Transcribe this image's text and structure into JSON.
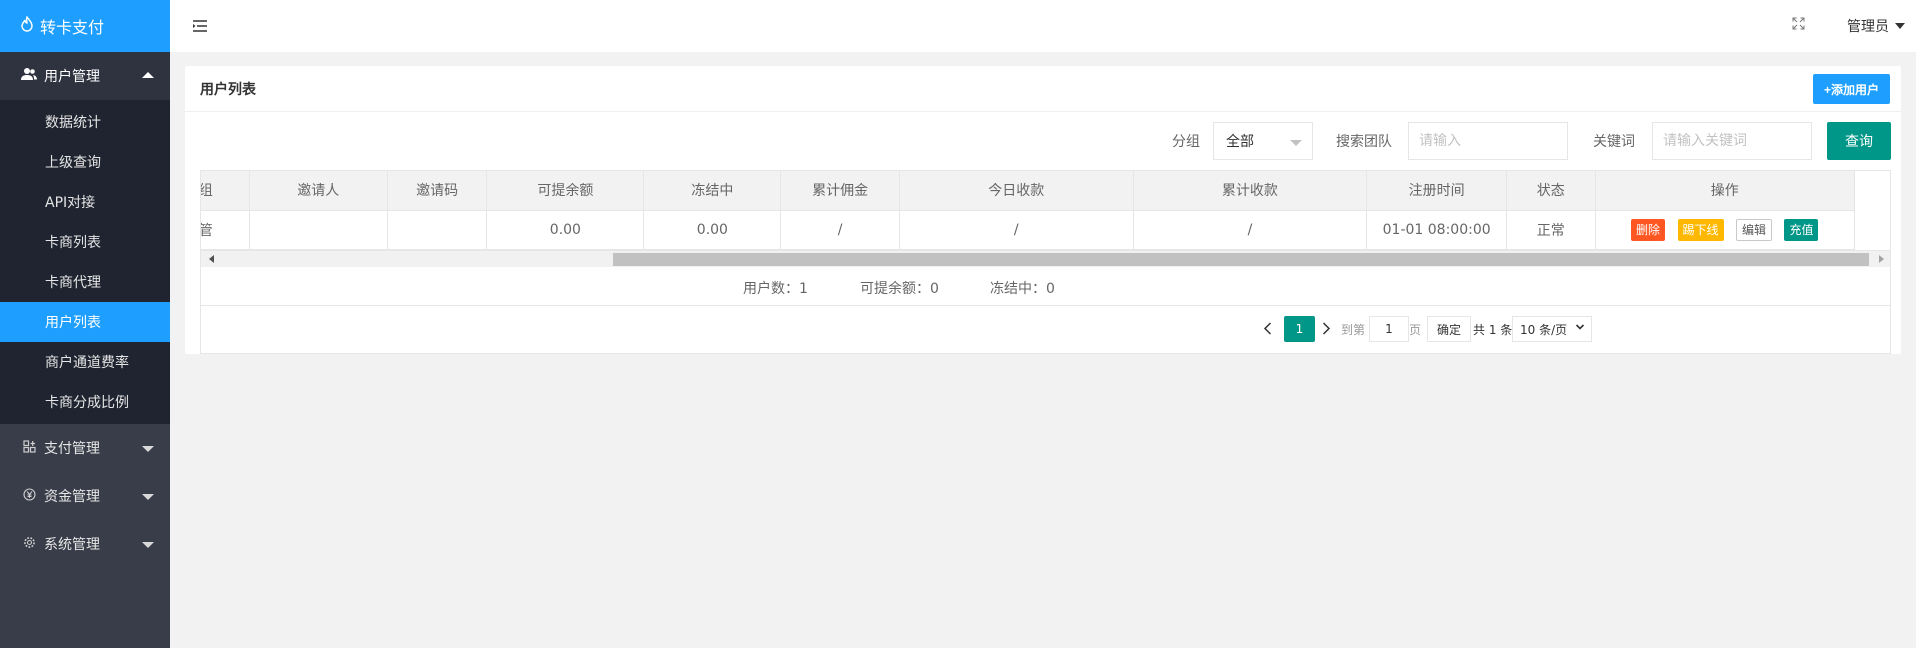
{
  "app": {
    "logo_text": "转卡支付",
    "logo_icon": "flame-icon"
  },
  "sidebar": {
    "groups": [
      {
        "label": "用户管理",
        "icon": "users-icon",
        "expanded": true,
        "items": [
          {
            "label": "数据统计"
          },
          {
            "label": "上级查询"
          },
          {
            "label": "API对接"
          },
          {
            "label": "卡商列表"
          },
          {
            "label": "卡商代理"
          },
          {
            "label": "用户列表",
            "active": true
          },
          {
            "label": "商户通道费率"
          },
          {
            "label": "卡商分成比例"
          }
        ]
      },
      {
        "label": "支付管理",
        "icon": "payment-icon",
        "expanded": false
      },
      {
        "label": "资金管理",
        "icon": "yen-icon",
        "expanded": false
      },
      {
        "label": "系统管理",
        "icon": "gear-icon",
        "expanded": false
      }
    ]
  },
  "header": {
    "user_label": "管理员"
  },
  "card": {
    "title": "用户列表",
    "add_button": "+添加用户"
  },
  "filters": {
    "group_label": "分组",
    "group_value": "全部",
    "team_label": "搜索团队",
    "team_placeholder": "请输入",
    "keyword_label": "关键词",
    "keyword_placeholder": "请输入关键词",
    "query_button": "查询"
  },
  "table": {
    "columns": [
      "分组",
      "邀请人",
      "邀请码",
      "可提余额",
      "冻结中",
      "累计佣金",
      "今日收款",
      "累计收款",
      "注册时间",
      "状态",
      "操作"
    ],
    "rows": [
      {
        "group": "管",
        "inviter": "",
        "invite_code": "",
        "balance": "0.00",
        "frozen": "0.00",
        "commission": "/",
        "today_income": "/",
        "total_income": "/",
        "reg_time": "01-01 08:00:00",
        "status": "正常",
        "ops": [
          "删除",
          "踢下线",
          "编辑",
          "充值"
        ]
      }
    ]
  },
  "totals": {
    "user_count": "用户数：1",
    "balance_total": "可提余额：0",
    "frozen_total": "冻结中：0"
  },
  "pagination": {
    "current_page": "1",
    "goto_label": "到第",
    "goto_value": "1",
    "page_unit": "页",
    "confirm": "确定",
    "total": "共 1 条",
    "page_size": "10 条/页"
  },
  "colors": {
    "sidebar_bg": "#393d49",
    "accent_blue": "#1e9fff",
    "accent_green": "#009688",
    "danger": "#ff5722",
    "warn": "#ffb800"
  }
}
